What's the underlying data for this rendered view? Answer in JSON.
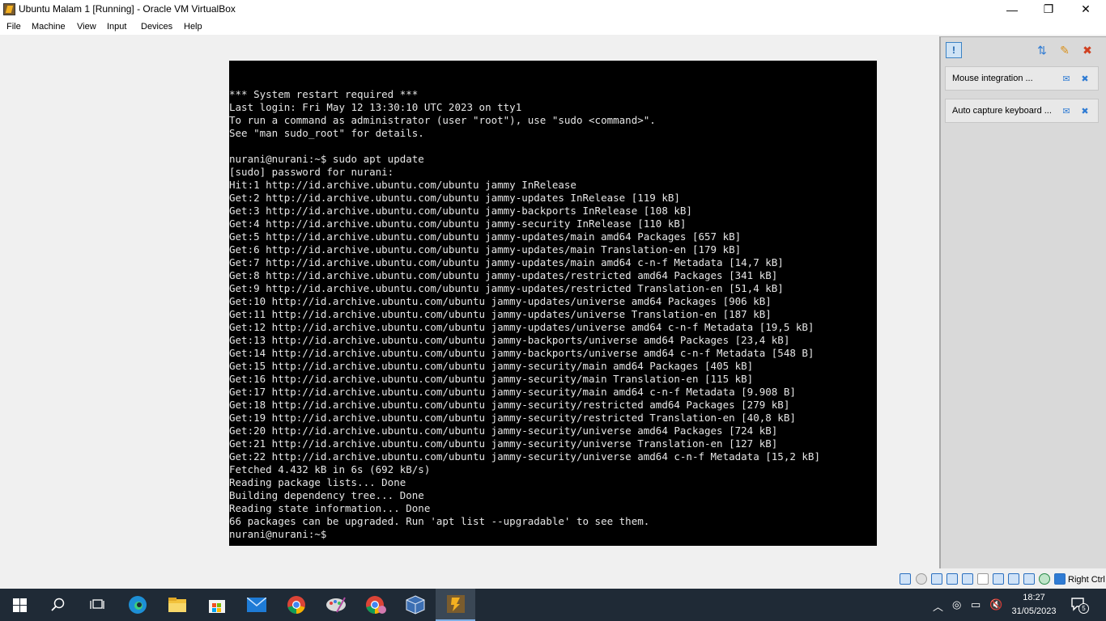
{
  "window": {
    "title": "Ubuntu Malam 1 [Running] - Oracle VM VirtualBox",
    "controls": {
      "minimize": "—",
      "maximize": "❐",
      "close": "✕"
    }
  },
  "menu": [
    "File",
    "Machine",
    "View",
    "Input",
    "Devices",
    "Help"
  ],
  "terminal": {
    "lines": [
      "*** System restart required ***",
      "Last login: Fri May 12 13:30:10 UTC 2023 on tty1",
      "To run a command as administrator (user \"root\"), use \"sudo <command>\".",
      "See \"man sudo_root\" for details.",
      "",
      "nurani@nurani:~$ sudo apt update",
      "[sudo] password for nurani:",
      "Hit:1 http://id.archive.ubuntu.com/ubuntu jammy InRelease",
      "Get:2 http://id.archive.ubuntu.com/ubuntu jammy-updates InRelease [119 kB]",
      "Get:3 http://id.archive.ubuntu.com/ubuntu jammy-backports InRelease [108 kB]",
      "Get:4 http://id.archive.ubuntu.com/ubuntu jammy-security InRelease [110 kB]",
      "Get:5 http://id.archive.ubuntu.com/ubuntu jammy-updates/main amd64 Packages [657 kB]",
      "Get:6 http://id.archive.ubuntu.com/ubuntu jammy-updates/main Translation-en [179 kB]",
      "Get:7 http://id.archive.ubuntu.com/ubuntu jammy-updates/main amd64 c-n-f Metadata [14,7 kB]",
      "Get:8 http://id.archive.ubuntu.com/ubuntu jammy-updates/restricted amd64 Packages [341 kB]",
      "Get:9 http://id.archive.ubuntu.com/ubuntu jammy-updates/restricted Translation-en [51,4 kB]",
      "Get:10 http://id.archive.ubuntu.com/ubuntu jammy-updates/universe amd64 Packages [906 kB]",
      "Get:11 http://id.archive.ubuntu.com/ubuntu jammy-updates/universe Translation-en [187 kB]",
      "Get:12 http://id.archive.ubuntu.com/ubuntu jammy-updates/universe amd64 c-n-f Metadata [19,5 kB]",
      "Get:13 http://id.archive.ubuntu.com/ubuntu jammy-backports/universe amd64 Packages [23,4 kB]",
      "Get:14 http://id.archive.ubuntu.com/ubuntu jammy-backports/universe amd64 c-n-f Metadata [548 B]",
      "Get:15 http://id.archive.ubuntu.com/ubuntu jammy-security/main amd64 Packages [405 kB]",
      "Get:16 http://id.archive.ubuntu.com/ubuntu jammy-security/main Translation-en [115 kB]",
      "Get:17 http://id.archive.ubuntu.com/ubuntu jammy-security/main amd64 c-n-f Metadata [9.908 B]",
      "Get:18 http://id.archive.ubuntu.com/ubuntu jammy-security/restricted amd64 Packages [279 kB]",
      "Get:19 http://id.archive.ubuntu.com/ubuntu jammy-security/restricted Translation-en [40,8 kB]",
      "Get:20 http://id.archive.ubuntu.com/ubuntu jammy-security/universe amd64 Packages [724 kB]",
      "Get:21 http://id.archive.ubuntu.com/ubuntu jammy-security/universe Translation-en [127 kB]",
      "Get:22 http://id.archive.ubuntu.com/ubuntu jammy-security/universe amd64 c-n-f Metadata [15,2 kB]",
      "Fetched 4.432 kB in 6s (692 kB/s)",
      "Reading package lists... Done",
      "Building dependency tree... Done",
      "Reading state information... Done",
      "66 packages can be upgraded. Run 'apt list --upgradable' to see them.",
      "nurani@nurani:~$"
    ]
  },
  "notifications": [
    {
      "text": "Mouse integration ..."
    },
    {
      "text": "Auto capture keyboard ..."
    }
  ],
  "statusbar": {
    "host_key": "Right Ctrl",
    "icons": [
      "hard-disk-icon",
      "optical-drive-icon",
      "audio-icon",
      "network-icon",
      "usb-icon",
      "shared-folder-icon",
      "display-icon",
      "video-capture-icon",
      "cpu-icon",
      "mouse-integration-icon",
      "keyboard-capture-icon"
    ]
  },
  "taskbar": {
    "apps": [
      "windows-start-icon",
      "search-icon",
      "task-view-icon",
      "edge-icon",
      "file-explorer-icon",
      "microsoft-store-icon",
      "mail-icon",
      "chrome-icon",
      "paint-icon",
      "chrome-profile-icon",
      "virtualbox-icon",
      "virtualbox-vm-icon"
    ],
    "time": "18:27",
    "date": "31/05/2023",
    "notification_count": "5"
  },
  "colors": {
    "terminal_bg": "#000000",
    "terminal_fg": "#e6e6e6",
    "taskbar_bg": "#1f2a36",
    "accent": "#2f7bd3"
  }
}
